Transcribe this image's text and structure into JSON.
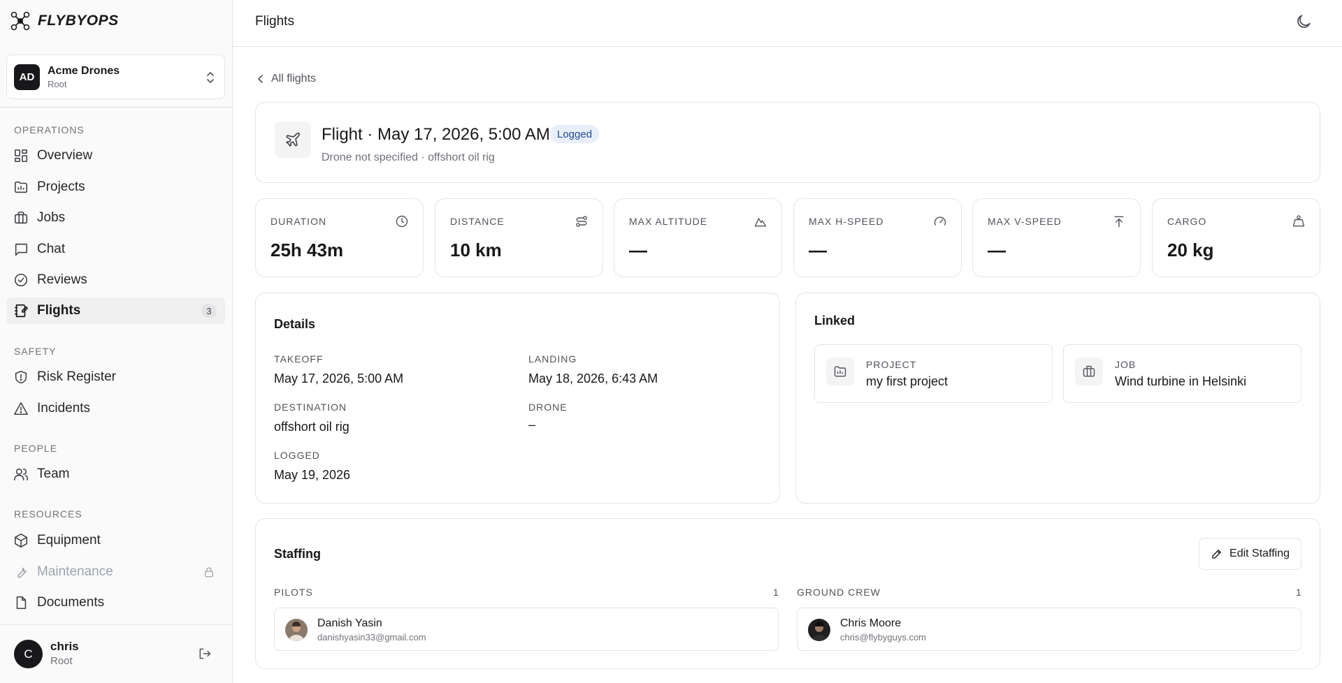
{
  "brand": {
    "name": "FLYBYOPS"
  },
  "org": {
    "initials": "AD",
    "name": "Acme Drones",
    "role": "Root"
  },
  "sidebar": {
    "sections": [
      {
        "label": "OPERATIONS",
        "items": [
          {
            "label": "Overview",
            "icon": "grid-icon"
          },
          {
            "label": "Projects",
            "icon": "folder-icon"
          },
          {
            "label": "Jobs",
            "icon": "briefcase-icon"
          },
          {
            "label": "Chat",
            "icon": "chat-icon"
          },
          {
            "label": "Reviews",
            "icon": "check-circle-icon"
          },
          {
            "label": "Flights",
            "icon": "logbook-icon",
            "badge": "3",
            "active": true
          }
        ]
      },
      {
        "label": "SAFETY",
        "items": [
          {
            "label": "Risk Register",
            "icon": "shield-icon"
          },
          {
            "label": "Incidents",
            "icon": "warning-icon"
          }
        ]
      },
      {
        "label": "PEOPLE",
        "items": [
          {
            "label": "Team",
            "icon": "users-icon"
          }
        ]
      },
      {
        "label": "RESOURCES",
        "items": [
          {
            "label": "Equipment",
            "icon": "box-icon"
          },
          {
            "label": "Maintenance",
            "icon": "wrench-icon",
            "locked": true
          },
          {
            "label": "Documents",
            "icon": "document-icon"
          }
        ]
      }
    ]
  },
  "user": {
    "initial": "C",
    "name": "chris",
    "role": "Root"
  },
  "header": {
    "title": "Flights"
  },
  "back_link": "All flights",
  "flight": {
    "title": "Flight · May 17, 2026, 5:00 AM",
    "status": "Logged",
    "subtitle": "Drone not specified · offshort oil rig"
  },
  "stats": [
    {
      "label": "DURATION",
      "value": "25h 43m",
      "icon": "clock-icon"
    },
    {
      "label": "DISTANCE",
      "value": "10 km",
      "icon": "route-icon"
    },
    {
      "label": "MAX ALTITUDE",
      "value": "—",
      "icon": "mountain-icon"
    },
    {
      "label": "MAX H-SPEED",
      "value": "—",
      "icon": "gauge-icon"
    },
    {
      "label": "MAX V-SPEED",
      "value": "—",
      "icon": "arrow-up-icon"
    },
    {
      "label": "CARGO",
      "value": "20 kg",
      "icon": "weight-icon"
    }
  ],
  "details": {
    "title": "Details",
    "takeoff_label": "TAKEOFF",
    "takeoff": "May 17, 2026, 5:00 AM",
    "landing_label": "LANDING",
    "landing": "May 18, 2026, 6:43 AM",
    "destination_label": "DESTINATION",
    "destination": "offshort oil rig",
    "drone_label": "DRONE",
    "drone": "–",
    "logged_label": "LOGGED",
    "logged": "May 19, 2026"
  },
  "linked": {
    "title": "Linked",
    "project_label": "PROJECT",
    "project": "my first project",
    "job_label": "JOB",
    "job": "Wind turbine in Helsinki"
  },
  "staffing": {
    "title": "Staffing",
    "edit_label": "Edit Staffing",
    "pilots_label": "PILOTS",
    "pilots_count": "1",
    "crew_label": "GROUND CREW",
    "crew_count": "1",
    "pilot": {
      "name": "Danish Yasin",
      "email": "danishyasin33@gmail.com"
    },
    "crew": {
      "name": "Chris Moore",
      "email": "chris@flybyguys.com"
    }
  }
}
